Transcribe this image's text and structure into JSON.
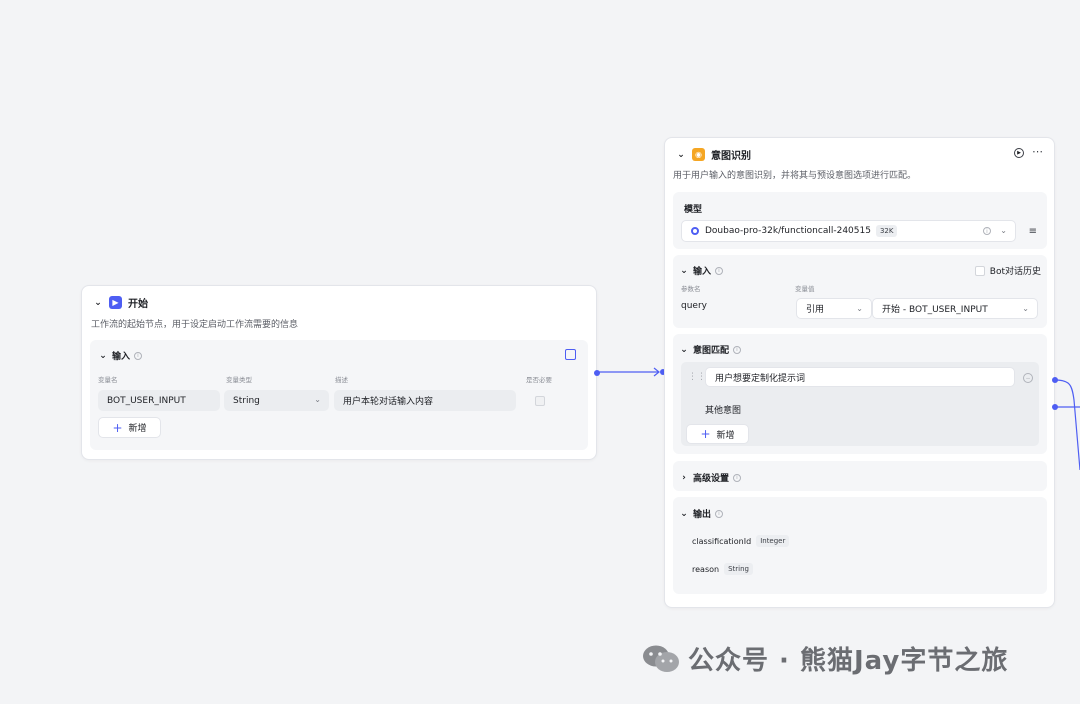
{
  "start_node": {
    "title": "开始",
    "description": "工作流的起始节点，用于设定启动工作流需要的信息",
    "input_section": {
      "title": "输入",
      "columns": [
        "变量名",
        "变量类型",
        "描述",
        "是否必要"
      ],
      "rows": [
        {
          "name": "BOT_USER_INPUT",
          "type": "String",
          "description": "用户本轮对话输入内容",
          "required": false
        }
      ],
      "add_label": "新增"
    }
  },
  "intent_node": {
    "title": "意图识别",
    "description": "用于用户输入的意图识别，并将其与预设意图选项进行匹配。",
    "model_section": {
      "title": "模型",
      "model_name": "Doubao-pro-32k/functioncall-240515",
      "context_badge": "32K"
    },
    "input_section": {
      "title": "输入",
      "history_label": "Bot对话历史",
      "columns": [
        "参数名",
        "变量值"
      ],
      "param_name": "query",
      "value_mode": "引用",
      "value_ref": "开始 - BOT_USER_INPUT"
    },
    "intent_section": {
      "title": "意图匹配",
      "intents": [
        "用户想要定制化提示词"
      ],
      "other_intent": "其他意图",
      "add_label": "新增"
    },
    "advanced_section": {
      "title": "高级设置"
    },
    "output_section": {
      "title": "输出",
      "fields": [
        {
          "name": "classificationId",
          "type": "Integer"
        },
        {
          "name": "reason",
          "type": "String"
        }
      ]
    }
  },
  "watermark": {
    "text": "公众号 · 熊猫Jay字节之旅"
  },
  "colors": {
    "accent": "#4e5ef3",
    "start_icon": "#4e5ef3",
    "intent_icon": "#f5a623",
    "canvas_bg": "#f3f4f6"
  }
}
